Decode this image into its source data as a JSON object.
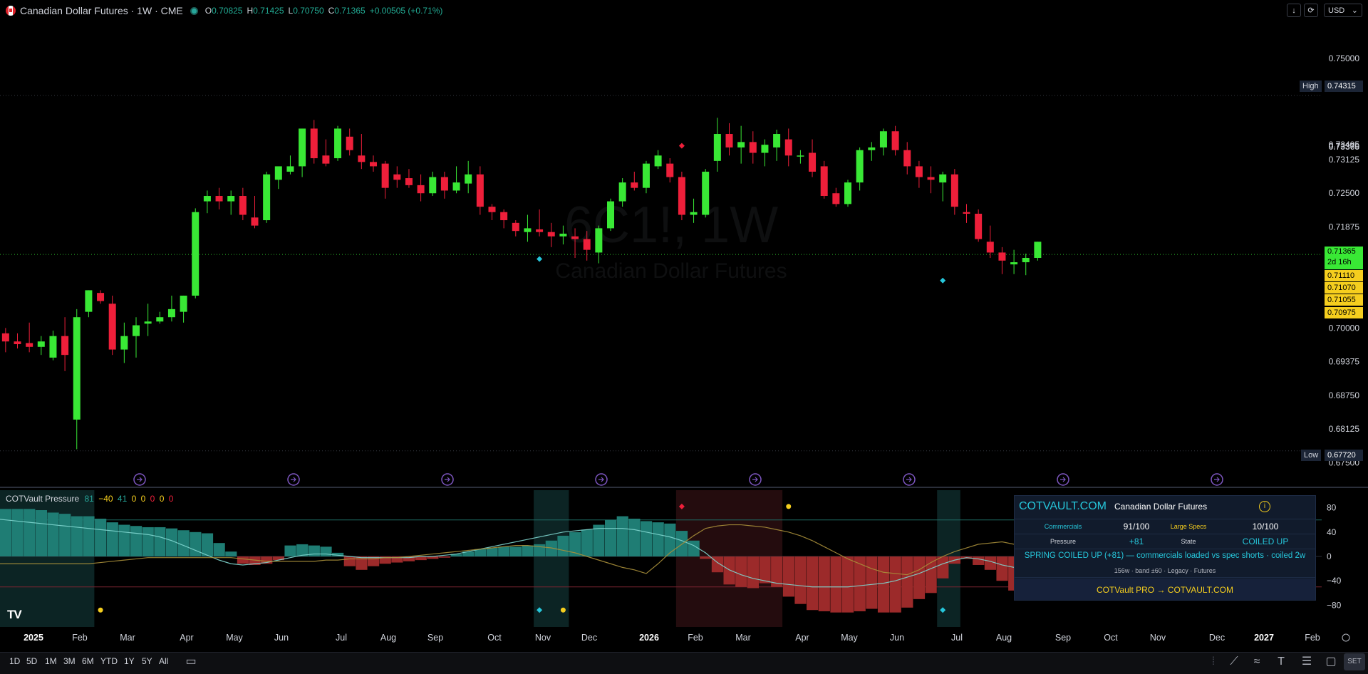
{
  "header": {
    "symbol": "Canadian Dollar Futures · 1W · CME",
    "o_label": "O",
    "o": "0.70825",
    "h_label": "H",
    "h": "0.71425",
    "l_label": "L",
    "l": "0.70750",
    "c_label": "C",
    "c": "0.71365",
    "change": "+0.00505 (+0.71%)"
  },
  "controls": {
    "currency": "USD",
    "download_icon": "arrow-down-icon",
    "fullscreen_icon": "screenshot-icon"
  },
  "watermark": {
    "ticker": "6C1!, 1W",
    "name": "Canadian Dollar Futures"
  },
  "price_badges": {
    "high_label": "High",
    "high": "0.74315",
    "low_label": "Low",
    "low": "0.67720",
    "last": "0.71365",
    "countdown": "2d 16h",
    "levels": [
      "0.71110",
      "0.71070",
      "0.71055",
      "0.70975"
    ]
  },
  "colors": {
    "up": "#39e835",
    "down": "#ee1f3a",
    "teal": "#26a69a",
    "hist_pos": "#1f7d74",
    "hist_neg": "#9c2a2a",
    "yellow": "#f5ce1e",
    "panel_bg": "#111b2c"
  },
  "chart_data": [
    {
      "type": "candlestick",
      "title": "Canadian Dollar Futures · 1W · CME",
      "y_axis_ticks": [
        "0.75000",
        "0.73405",
        "0.73370",
        "0.73365",
        "0.73125",
        "0.72500",
        "0.71875",
        "0.70000",
        "0.69375",
        "0.68750",
        "0.68125",
        "0.67500"
      ],
      "ylim": [
        0.674,
        0.752
      ],
      "x_axis_ticks": [
        "2025",
        "Feb",
        "Mar",
        "Apr",
        "May",
        "Jun",
        "Jul",
        "Aug",
        "Sep",
        "Oct",
        "Nov",
        "Dec",
        "2026",
        "Feb",
        "Mar",
        "Apr",
        "May",
        "Jun",
        "Jul",
        "Aug",
        "Sep",
        "Oct",
        "Nov",
        "Dec",
        "2027",
        "Feb"
      ],
      "candles": [
        [
          0.703,
          0.704,
          0.698,
          0.6992
        ],
        [
          0.699,
          0.7,
          0.6955,
          0.6975
        ],
        [
          0.6975,
          0.699,
          0.6962,
          0.697
        ],
        [
          0.6972,
          0.701,
          0.6955,
          0.6965
        ],
        [
          0.6965,
          0.6985,
          0.695,
          0.6975
        ],
        [
          0.6945,
          0.6995,
          0.694,
          0.6985
        ],
        [
          0.6985,
          0.702,
          0.692,
          0.695
        ],
        [
          0.683,
          0.7035,
          0.6775,
          0.702
        ],
        [
          0.703,
          0.707,
          0.702,
          0.707
        ],
        [
          0.7065,
          0.707,
          0.7045,
          0.705
        ],
        [
          0.7045,
          0.706,
          0.695,
          0.696
        ],
        [
          0.696,
          0.701,
          0.6935,
          0.6985
        ],
        [
          0.6985,
          0.702,
          0.6945,
          0.7005
        ],
        [
          0.7008,
          0.7045,
          0.6985,
          0.7012
        ],
        [
          0.7012,
          0.703,
          0.7008,
          0.702
        ],
        [
          0.702,
          0.706,
          0.7012,
          0.7035
        ],
        [
          0.703,
          0.706,
          0.701,
          0.706
        ],
        [
          0.706,
          0.7222,
          0.7055,
          0.7215
        ],
        [
          0.7235,
          0.7255,
          0.7213,
          0.7245
        ],
        [
          0.7245,
          0.726,
          0.722,
          0.7235
        ],
        [
          0.7235,
          0.7255,
          0.721,
          0.7245
        ],
        [
          0.7245,
          0.726,
          0.72,
          0.721
        ],
        [
          0.7205,
          0.7245,
          0.7185,
          0.719
        ],
        [
          0.72,
          0.729,
          0.7195,
          0.7285
        ],
        [
          0.7275,
          0.7295,
          0.7258,
          0.73
        ],
        [
          0.729,
          0.732,
          0.7285,
          0.73
        ],
        [
          0.73,
          0.737,
          0.728,
          0.737
        ],
        [
          0.737,
          0.7386,
          0.7305,
          0.7315
        ],
        [
          0.732,
          0.735,
          0.73,
          0.7305
        ],
        [
          0.7315,
          0.7375,
          0.731,
          0.737
        ],
        [
          0.7355,
          0.737,
          0.732,
          0.733
        ],
        [
          0.732,
          0.736,
          0.7295,
          0.7308
        ],
        [
          0.7308,
          0.732,
          0.729,
          0.73
        ],
        [
          0.7305,
          0.731,
          0.724,
          0.726
        ],
        [
          0.7285,
          0.73,
          0.726,
          0.7275
        ],
        [
          0.7278,
          0.7295,
          0.726,
          0.7265
        ],
        [
          0.7265,
          0.7285,
          0.7235,
          0.725
        ],
        [
          0.725,
          0.729,
          0.7245,
          0.728
        ],
        [
          0.728,
          0.729,
          0.724,
          0.7255
        ],
        [
          0.7255,
          0.73,
          0.725,
          0.727
        ],
        [
          0.7268,
          0.731,
          0.725,
          0.7285
        ],
        [
          0.7285,
          0.73,
          0.721,
          0.7225
        ],
        [
          0.7225,
          0.723,
          0.72,
          0.7215
        ],
        [
          0.7215,
          0.722,
          0.7185,
          0.72
        ],
        [
          0.7195,
          0.72,
          0.717,
          0.718
        ],
        [
          0.7178,
          0.721,
          0.716,
          0.7185
        ],
        [
          0.7183,
          0.722,
          0.717,
          0.7178
        ],
        [
          0.7178,
          0.7195,
          0.715,
          0.717
        ],
        [
          0.717,
          0.719,
          0.7155,
          0.7175
        ],
        [
          0.717,
          0.7185,
          0.713,
          0.7165
        ],
        [
          0.7165,
          0.718,
          0.7125,
          0.7145
        ],
        [
          0.714,
          0.719,
          0.712,
          0.7185
        ],
        [
          0.7185,
          0.724,
          0.718,
          0.7235
        ],
        [
          0.7235,
          0.7278,
          0.7225,
          0.727
        ],
        [
          0.727,
          0.729,
          0.7255,
          0.726
        ],
        [
          0.726,
          0.731,
          0.725,
          0.7305
        ],
        [
          0.73,
          0.733,
          0.7295,
          0.732
        ],
        [
          0.7305,
          0.7315,
          0.727,
          0.728
        ],
        [
          0.728,
          0.729,
          0.72,
          0.721
        ],
        [
          0.721,
          0.724,
          0.7195,
          0.7215
        ],
        [
          0.721,
          0.7295,
          0.7205,
          0.729
        ],
        [
          0.731,
          0.739,
          0.729,
          0.736
        ],
        [
          0.736,
          0.738,
          0.732,
          0.7335
        ],
        [
          0.7335,
          0.7375,
          0.7305,
          0.7345
        ],
        [
          0.7345,
          0.7365,
          0.7305,
          0.7325
        ],
        [
          0.7325,
          0.735,
          0.73,
          0.734
        ],
        [
          0.7335,
          0.7368,
          0.731,
          0.736
        ],
        [
          0.735,
          0.737,
          0.73,
          0.732
        ],
        [
          0.732,
          0.733,
          0.7305,
          0.732
        ],
        [
          0.7325,
          0.735,
          0.728,
          0.729
        ],
        [
          0.73,
          0.731,
          0.724,
          0.7245
        ],
        [
          0.725,
          0.726,
          0.7225,
          0.723
        ],
        [
          0.723,
          0.7275,
          0.7225,
          0.727
        ],
        [
          0.727,
          0.7335,
          0.7255,
          0.733
        ],
        [
          0.733,
          0.7345,
          0.731,
          0.7335
        ],
        [
          0.7335,
          0.737,
          0.732,
          0.7365
        ],
        [
          0.7365,
          0.7375,
          0.732,
          0.733
        ],
        [
          0.733,
          0.7345,
          0.7285,
          0.73
        ],
        [
          0.73,
          0.731,
          0.726,
          0.728
        ],
        [
          0.728,
          0.73,
          0.725,
          0.7275
        ],
        [
          0.727,
          0.729,
          0.7235,
          0.7285
        ],
        [
          0.7285,
          0.7295,
          0.721,
          0.7225
        ],
        [
          0.7215,
          0.723,
          0.7195,
          0.7212
        ],
        [
          0.7212,
          0.722,
          0.716,
          0.7165
        ],
        [
          0.716,
          0.719,
          0.713,
          0.714
        ],
        [
          0.714,
          0.715,
          0.71,
          0.7125
        ],
        [
          0.7118,
          0.7145,
          0.71,
          0.7122
        ],
        [
          0.7122,
          0.7138,
          0.7098,
          0.713
        ],
        [
          0.713,
          0.716,
          0.7125,
          0.716
        ]
      ]
    },
    {
      "type": "bar",
      "title": "COTVault Pressure",
      "legend_values": [
        "81",
        "−40",
        "41",
        "0",
        "0",
        "0",
        "0",
        "0"
      ],
      "y_axis_ticks": [
        "80",
        "40",
        "0",
        "−40",
        "−80"
      ],
      "ylim": [
        -100,
        100
      ],
      "histogram": [
        78,
        78,
        78,
        78,
        76,
        72,
        70,
        66,
        66,
        62,
        56,
        52,
        50,
        48,
        48,
        46,
        43,
        40,
        38,
        22,
        8,
        -12,
        -14,
        -12,
        -6,
        18,
        20,
        18,
        16,
        6,
        -16,
        -22,
        -16,
        -12,
        -10,
        -8,
        -6,
        -4,
        -2,
        4,
        8,
        12,
        14,
        16,
        16,
        18,
        20,
        26,
        34,
        40,
        44,
        52,
        60,
        66,
        62,
        58,
        56,
        54,
        42,
        26,
        -4,
        -26,
        -46,
        -50,
        -52,
        -44,
        -50,
        -66,
        -78,
        -88,
        -90,
        -92,
        -92,
        -90,
        -86,
        -92,
        -92,
        -84,
        -70,
        -60,
        -36,
        -12,
        -4,
        -14,
        -22,
        -40,
        -56,
        -56,
        -40,
        -30,
        -4,
        14,
        24,
        34,
        46,
        60,
        64,
        80
      ],
      "signal_line": [
        62,
        60,
        58,
        56,
        54,
        52,
        50,
        48,
        46,
        44,
        42,
        40,
        38,
        36,
        32,
        26,
        18,
        10,
        2,
        -6,
        -12,
        -14,
        -12,
        -10,
        -6,
        -2,
        2,
        4,
        4,
        2,
        0,
        -2,
        -2,
        -2,
        -2,
        -2,
        0,
        0,
        2,
        4,
        8,
        12,
        16,
        20,
        24,
        28,
        32,
        36,
        40,
        42,
        44,
        46,
        46,
        46,
        44,
        40,
        36,
        32,
        26,
        18,
        6,
        -10,
        -22,
        -30,
        -36,
        -40,
        -44,
        -46,
        -48,
        -50,
        -50,
        -50,
        -50,
        -48,
        -46,
        -44,
        -40,
        -34,
        -28,
        -20,
        -12,
        -6,
        -2,
        -4,
        -8,
        -14,
        -18,
        -20,
        -18,
        -12,
        -4,
        4,
        12,
        18,
        22,
        26,
        30
      ],
      "trend_line": [
        -12,
        -12,
        -12,
        -12,
        -12,
        -12,
        -12,
        -12,
        -12,
        -10,
        -8,
        -6,
        -4,
        -2,
        -2,
        -2,
        -2,
        -2,
        -2,
        -2,
        -2,
        -4,
        -6,
        -8,
        -8,
        -8,
        -8,
        -8,
        -6,
        -6,
        -4,
        -4,
        -4,
        -2,
        -2,
        0,
        2,
        4,
        6,
        8,
        10,
        12,
        14,
        16,
        18,
        18,
        16,
        14,
        10,
        6,
        0,
        -6,
        -12,
        -18,
        -22,
        -28,
        -12,
        6,
        20,
        34,
        46,
        50,
        52,
        52,
        50,
        48,
        44,
        40,
        34,
        26,
        16,
        6,
        -4,
        -12,
        -20,
        -26,
        -28,
        -30,
        -22,
        -10,
        0,
        8,
        14,
        20,
        22,
        24,
        20,
        16,
        10,
        4,
        0,
        -4,
        -8,
        -14,
        -20,
        -26,
        -36
      ],
      "markers": [
        {
          "week": 9,
          "kind": "dot",
          "color": "yellow",
          "value": -88
        },
        {
          "week": 46,
          "kind": "diamond",
          "color": "teal",
          "value": -88
        },
        {
          "week": 48,
          "kind": "dot",
          "color": "yellow",
          "value": -88
        },
        {
          "week": 58,
          "kind": "diamond",
          "color": "red",
          "value": 82
        },
        {
          "week": 67,
          "kind": "dot",
          "color": "yellow",
          "value": 82
        },
        {
          "week": 80,
          "kind": "diamond",
          "color": "teal",
          "value": -88
        }
      ]
    }
  ],
  "price_markers": [
    {
      "week": 46,
      "kind": "diamond",
      "color": "teal",
      "price": 0.7128
    },
    {
      "week": 58,
      "kind": "diamond",
      "color": "red",
      "price": 0.7338
    },
    {
      "week": 80,
      "kind": "diamond",
      "color": "teal",
      "price": 0.7088
    }
  ],
  "cot_panel": {
    "site": "COTVAULT.COM",
    "instrument": "Canadian Dollar Futures",
    "info_icon": "info-icon",
    "commercials_label": "Commercials",
    "commercials_value": "91/100",
    "specs_label": "Large Specs",
    "specs_value": "10/100",
    "pressure_label": "Pressure",
    "pressure_value": "+81",
    "state_label": "State",
    "state_value": "COILED UP",
    "signal": "SPRING COILED UP (+81) — commercials loaded vs spec shorts · coiled 2w",
    "meta": "156w · band ±60 · Legacy · Futures",
    "promo": "COTVault PRO → COTVAULT.COM"
  },
  "bottom_toolbar": {
    "ranges": [
      "1D",
      "5D",
      "1M",
      "3M",
      "6M",
      "YTD",
      "1Y",
      "5Y",
      "All"
    ],
    "calendar_icon": "calendar-icon",
    "logo": "TV",
    "tools": [
      "dots-icon",
      "trendline-icon",
      "fib-icon",
      "text-icon",
      "lines-icon",
      "rectangle-icon"
    ],
    "set_label": "SET"
  }
}
